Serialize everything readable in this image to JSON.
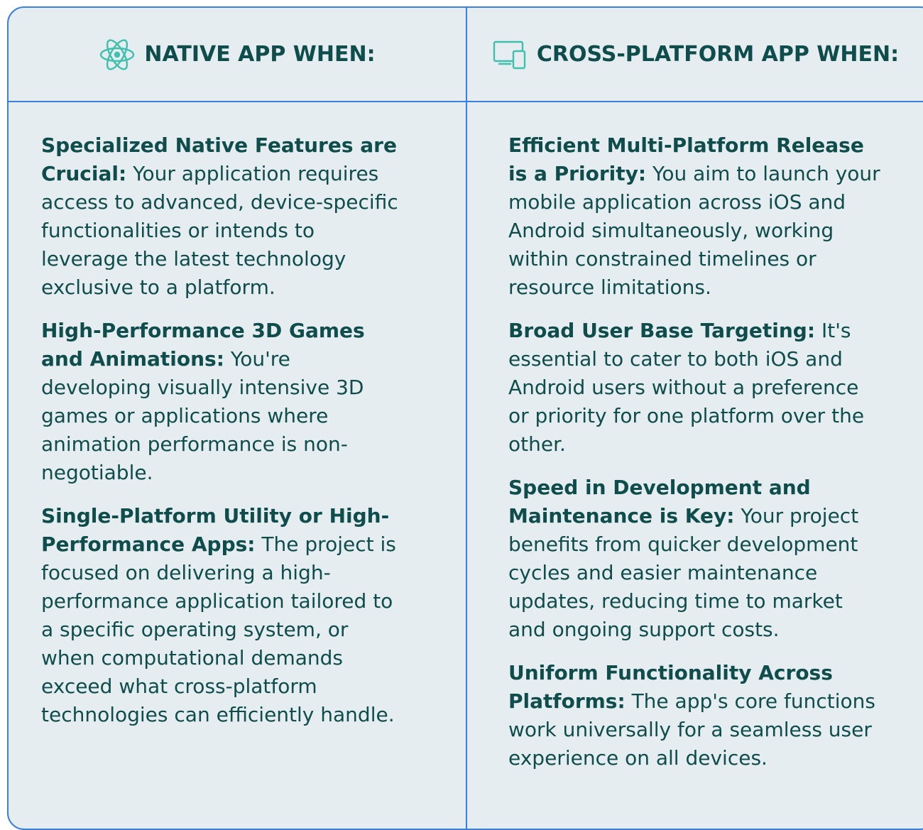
{
  "native": {
    "icon": "react-atom-icon",
    "title": "NATIVE APP WHEN:",
    "items": [
      {
        "lead": "Specialized Native Features are Crucial:",
        "text": "Your application requires access to advanced, device-specific functionalities or intends to leverage the latest technology exclusive to a platform."
      },
      {
        "lead": "High-Performance 3D Games and Animations:",
        "text": "You're developing visually intensive 3D games or applications where animation performance is non-negotiable."
      },
      {
        "lead": "Single-Platform Utility or High-Performance Apps:",
        "text": "The project is focused on delivering a high-performance application tailored to a specific operating system, or when computational demands exceed what cross-platform technologies can efficiently handle."
      }
    ]
  },
  "cross": {
    "icon": "devices-icon",
    "title": "CROSS-PLATFORM APP WHEN:",
    "items": [
      {
        "lead": "Efficient Multi-Platform Release is a Priority:",
        "text": "You aim to launch your mobile application across iOS and Android simultaneously, working within constrained timelines or resource limitations."
      },
      {
        "lead": "Broad User Base Targeting:",
        "text": "It's essential to cater to both iOS and Android users without a preference or priority for one platform over the other."
      },
      {
        "lead": "Speed in Development and Maintenance is Key:",
        "text": "Your project benefits from quicker development cycles and easier maintenance updates, reducing time to market and ongoing support costs."
      },
      {
        "lead": "Uniform Functionality Across Platforms:",
        "text": "The app's core functions work universally for a seamless user experience on all devices."
      }
    ]
  },
  "colors": {
    "card_background": "#e6edf0",
    "border": "#3b7fe0",
    "text": "#0f4c4c",
    "icon": "#3fbfae"
  }
}
